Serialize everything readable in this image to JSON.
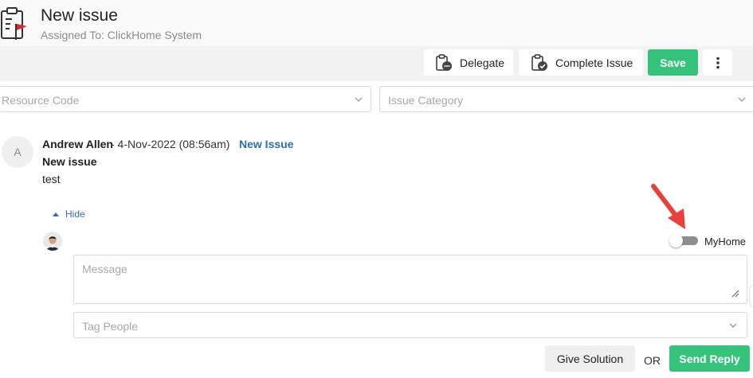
{
  "header": {
    "icon": "clipboard-flag-icon",
    "title": "New issue",
    "subtitle": "Assigned To: ClickHome System"
  },
  "toolbar": {
    "delegate_label": "Delegate",
    "delegate_icon": "clipboard-delegate-icon",
    "complete_label": "Complete Issue",
    "complete_icon": "clipboard-check-icon",
    "save_label": "Save",
    "more_icon": "kebab-menu-icon",
    "save_color": "#35c27b"
  },
  "filters": {
    "resource_code_placeholder": "Resource Code",
    "issue_category_placeholder": "Issue Category"
  },
  "comment": {
    "avatar_initial": "A",
    "author": "Andrew Allen",
    "date": " - 4-Nov-2022 (08:56am)",
    "tag": "New Issue",
    "title": "New issue",
    "body": "test"
  },
  "reply": {
    "hide_label": "Hide",
    "toggle_label": "MyHome",
    "toggle_on": false,
    "message_placeholder": "Message",
    "tag_people_placeholder": "Tag People",
    "give_solution_label": "Give Solution",
    "or_label": "OR",
    "send_reply_label": "Send Reply"
  },
  "colors": {
    "accent_green": "#35c27b",
    "link_blue": "#2f6fb0",
    "annotation_arrow": "#e8403a"
  }
}
